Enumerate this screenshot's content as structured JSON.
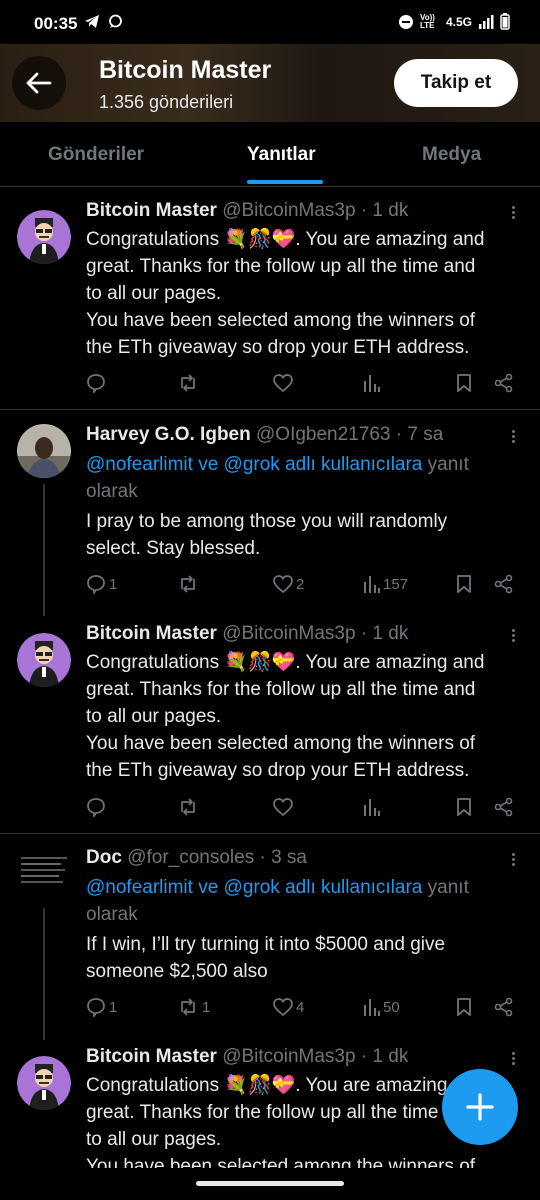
{
  "status_bar": {
    "time": "00:35",
    "network": "4.5G",
    "volte": "Vo)) LTE"
  },
  "header": {
    "title": "Bitcoin Master",
    "subtitle": "1.356 gönderileri",
    "follow_label": "Takip et"
  },
  "tabs": [
    {
      "label": "Gönderiler"
    },
    {
      "label": "Yanıtlar"
    },
    {
      "label": "Medya"
    }
  ],
  "active_tab": "Yanıtlar",
  "posts": [
    {
      "name": "Bitcoin Master",
      "meta": "@BitcoinMas3p · 1 dk",
      "lines": [
        "Congratulations 💐🎊💝. You are amazing and",
        "great. Thanks for the follow up all the time and",
        "to all our pages.",
        "You have been  selected among the winners of",
        "the ETh giveaway so drop your ETH address."
      ],
      "counts": {
        "reply": "",
        "repost": "",
        "like": "",
        "views": ""
      }
    },
    {
      "name": "Harvey G.O. Igben",
      "meta": "@OIgben21763 · 7 sa",
      "reply_to_mentions": "@nofearlimit ve @grok adlı kullanıcılara",
      "reply_to_suffix": "yanıt",
      "reply_to_line2": "olarak",
      "lines": [
        "I pray to be among those you will randomly",
        "select. Stay blessed."
      ],
      "counts": {
        "reply": "1",
        "repost": "",
        "like": "2",
        "views": "157"
      }
    },
    {
      "name": "Bitcoin Master",
      "meta": "@BitcoinMas3p · 1 dk",
      "lines": [
        "Congratulations 💐🎊💝. You are amazing and",
        "great. Thanks for the follow up all the time and",
        "to all our pages.",
        "You have been  selected among the winners of",
        "the ETh giveaway so drop your ETH address."
      ],
      "counts": {
        "reply": "",
        "repost": "",
        "like": "",
        "views": ""
      }
    },
    {
      "name": "Doc",
      "meta": "@for_consoles · 3 sa",
      "reply_to_mentions": "@nofearlimit ve @grok adlı kullanıcılara",
      "reply_to_suffix": "yanıt",
      "reply_to_line2": "olarak",
      "lines": [
        "If I win, I’ll try turning it into $5000 and give",
        "someone $2,500 also"
      ],
      "counts": {
        "reply": "1",
        "repost": "1",
        "like": "4",
        "views": "50"
      }
    },
    {
      "name": "Bitcoin Master",
      "meta": "@BitcoinMas3p · 1 dk",
      "lines": [
        "Congratulations 💐🎊💝. You are amazing and",
        "great. Thanks for the follow up all the time and",
        "to all our pages.",
        "You have been  selected among the winners of"
      ],
      "counts": {
        "reply": "",
        "repost": "",
        "like": "",
        "views": ""
      }
    }
  ],
  "colors": {
    "accent": "#1d9bf0",
    "text": "#e7e9ea",
    "muted": "#71767b",
    "divider": "#2f3336"
  }
}
